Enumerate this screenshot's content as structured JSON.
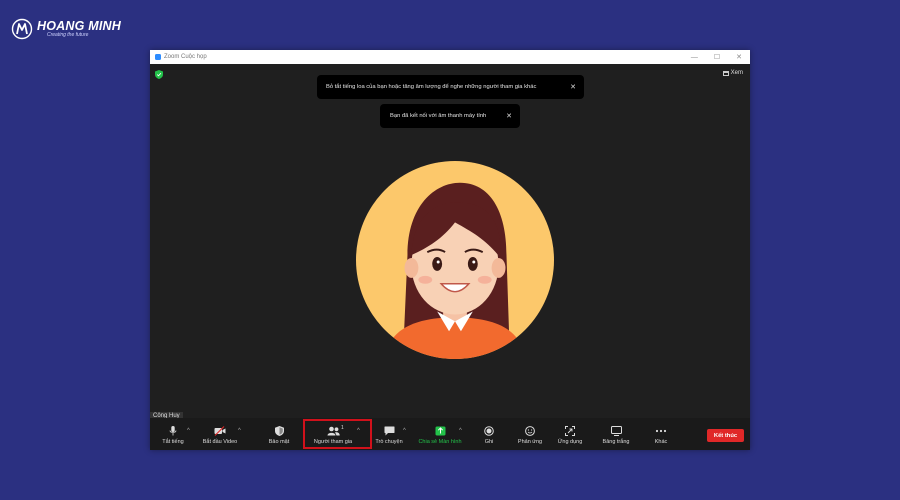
{
  "brand": {
    "name": "HOANG MINH",
    "tagline": "Creating the future"
  },
  "window": {
    "title": "Zoom Cuộc họp",
    "minimize": "—",
    "maximize": "☐",
    "close": "✕"
  },
  "view_label": "Xem",
  "notifications": [
    {
      "text": "Bỏ tắt tiếng loa của bạn hoặc tăng âm lượng để nghe những người tham gia khác",
      "close": "✕"
    },
    {
      "text": "Bạn đã kết nối với âm thanh máy tính",
      "close": "✕"
    }
  ],
  "participant_name": "Công Huy",
  "toolbar": {
    "mute": "Tắt tiếng",
    "video": "Bắt đầu Video",
    "security": "Bảo mật",
    "participants": "Người tham gia",
    "participants_count": "1",
    "chat": "Trò chuyện",
    "share": "Chia sẻ Màn hình",
    "record": "Ghi",
    "reactions": "Phản ứng",
    "apps": "Ứng dụng",
    "whiteboard": "Bảng trắng",
    "more": "Khác",
    "end": "Kết thúc",
    "caret": "^"
  },
  "colors": {
    "background": "#2b3081",
    "meeting_bg": "#1f1f1f",
    "end_button": "#e02828",
    "share_green": "#23c24a",
    "highlight_box": "#d0111b"
  }
}
